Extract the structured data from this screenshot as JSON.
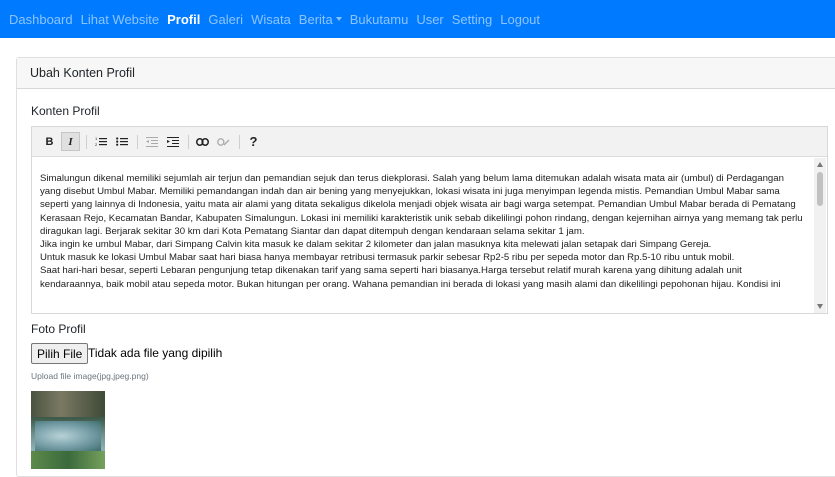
{
  "nav": {
    "items": [
      {
        "label": "Dashboard",
        "active": false
      },
      {
        "label": "Lihat Website",
        "active": false
      },
      {
        "label": "Profil",
        "active": true
      },
      {
        "label": "Galeri",
        "active": false
      },
      {
        "label": "Wisata",
        "active": false
      },
      {
        "label": "Berita",
        "active": false,
        "dropdown": true
      },
      {
        "label": "Bukutamu",
        "active": false
      },
      {
        "label": "User",
        "active": false
      },
      {
        "label": "Setting",
        "active": false
      },
      {
        "label": "Logout",
        "active": false
      }
    ]
  },
  "card": {
    "header": "Ubah Konten Profil"
  },
  "form": {
    "content_label": "Konten Profil",
    "photo_label": "Foto Profil",
    "file_button": "Pilih File",
    "file_status": "Tidak ada file yang dipilih",
    "file_hint": "Upload file image(jpg,jpeg.png)"
  },
  "editor": {
    "toolbar": [
      "bold-icon",
      "italic-icon",
      "ordered-list-icon",
      "unordered-list-icon",
      "outdent-icon",
      "indent-icon",
      "link-icon",
      "unlink-icon",
      "help-icon"
    ],
    "toolbar_labels": {
      "bold": "B",
      "italic": "I",
      "help": "?"
    },
    "paragraphs": [
      "Simalungun dikenal memiliki sejumlah air terjun dan pemandian sejuk dan terus diekplorasi. Salah yang belum lama ditemukan adalah wisata mata air (umbul) di Perdagangan yang disebut Umbul Mabar. Memiliki pemandangan indah dan air bening yang menyejukkan, lokasi wisata ini juga menyimpan legenda mistis. Pemandian Umbul Mabar sama seperti yang lainnya di Indonesia, yaitu mata air alami yang ditata sekaligus dikelola menjadi objek wisata air bagi warga setempat. Pemandian Umbul Mabar berada di Pematang Kerasaan Rejo, Kecamatan Bandar, Kabupaten Simalungun. Lokasi ini memiliki karakteristik unik sebab dikelilingi pohon rindang, dengan kejernihan airnya yang memang tak perlu diragukan lagi. Berjarak sekitar 30 km dari Kota Pematang Siantar dan dapat ditempuh dengan kendaraan selama sekitar 1 jam.",
      "Jika ingin ke umbul Mabar, dari Simpang Calvin kita masuk ke dalam sekitar 2 kilometer dan jalan masuknya kita melewati jalan setapak dari Simpang Gereja.",
      "Untuk masuk ke lokasi Umbul Mabar saat hari biasa hanya membayar retribusi termasuk parkir sebesar Rp2-5 ribu per sepeda motor dan Rp.5-10 ribu untuk mobil.",
      "Saat hari-hari besar, seperti Lebaran pengunjung tetap dikenakan tarif yang sama seperti hari biasanya.Harga tersebut relatif murah karena yang dihitung adalah unit kendaraannya, baik mobil atau sepeda motor. Bukan hitungan per orang. Wahana pemandian ini berada di lokasi yang masih alami dan dikelilingi pepohonan hijau. Kondisi ini"
    ]
  },
  "colors": {
    "navbar_bg": "#007bff"
  }
}
